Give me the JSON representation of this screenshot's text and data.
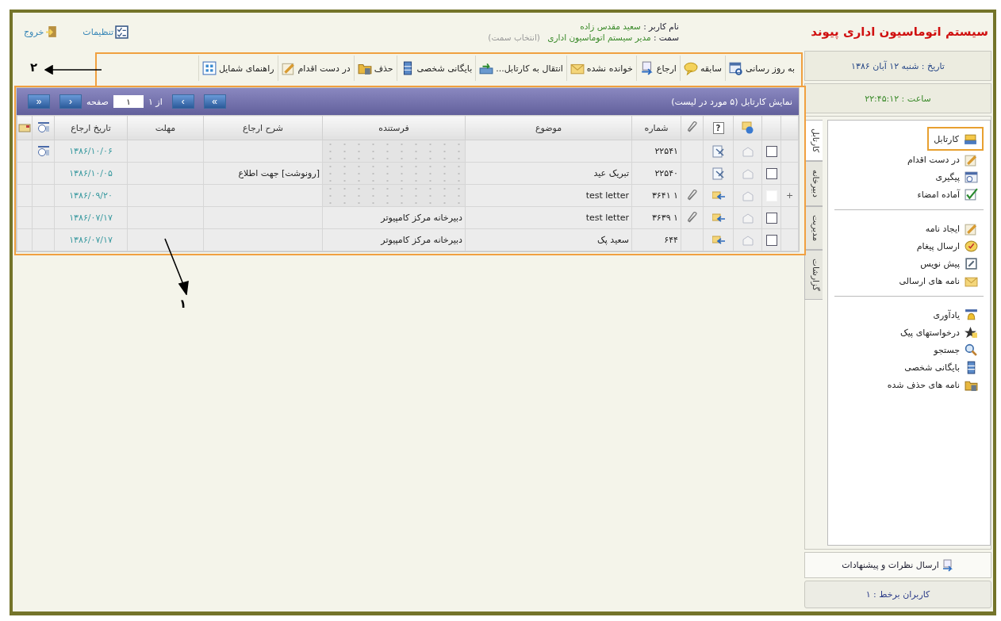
{
  "header": {
    "title": "سیستم اتوماسیون اداری پیوند",
    "user_label": "نام کاربر :",
    "user_name": "سعید مقدس زاده",
    "role_label": "سمت :",
    "role": "مدیر سیستم اتوماسیون اداری",
    "role_link": "(انتخاب سمت)",
    "links": [
      "تنظیمات",
      "خروج"
    ]
  },
  "date": "تاریخ : شنبه ۱۲ آبان ۱۳۸۶",
  "time": "ساعت : ۲۲:۴۵:۱۲",
  "toolbar": [
    "به روز رسانی",
    "سابقه",
    "ارجاع",
    "خوانده نشده",
    "انتقال به کارتابل...",
    "بایگانی شخصی",
    "حذف",
    "در دست اقدام",
    "راهنمای شمایل"
  ],
  "cartable": {
    "caption": "نمایش کارتابل (۵ مورد در لیست)",
    "pager": {
      "first": "«",
      "prev": "‹",
      "page_label": "صفحه",
      "page": "۱",
      "of": "از ۱",
      "next": "›",
      "last": "»"
    },
    "help_mark": "?",
    "columns": [
      "شماره",
      "موضوع",
      "فرستنده",
      "شرح ارجاع",
      "مهلت",
      "تاریخ ارجاع"
    ],
    "rows": [
      {
        "checkbox_shown": true,
        "checked": false,
        "kind": "draft",
        "attachment": false,
        "number": "۲۲۵۴۱",
        "subject": "",
        "sender_redacted": true,
        "sender": "",
        "note": "",
        "date": "۱۳۸۶/۱۰/۰۶",
        "reminder": true
      },
      {
        "checkbox_shown": true,
        "checked": false,
        "kind": "draft",
        "attachment": false,
        "number": "۲۲۵۴۰",
        "subject": "تبریک عید",
        "sender_redacted": true,
        "sender": "",
        "note": "[رونوشت] جهت اطلاع",
        "date": "۱۳۸۶/۱۰/۰۵",
        "reminder": false
      },
      {
        "expander": "+",
        "checkbox_shown": false,
        "checked": false,
        "kind": "forward",
        "attachment": true,
        "number": "۱ ۳۶۴۱",
        "subject": "test letter",
        "sender_redacted": true,
        "sender": "",
        "note": "",
        "date": "۱۳۸۶/۰۹/۲۰",
        "reminder": false
      },
      {
        "checkbox_shown": true,
        "checked": false,
        "kind": "forward",
        "attachment": true,
        "number": "۱ ۳۶۳۹",
        "subject": "test letter",
        "sender_redacted": false,
        "sender": "دبیرخانه مرکز کامپیوتر",
        "note": "",
        "date": "۱۳۸۶/۰۷/۱۷",
        "reminder": false
      },
      {
        "checkbox_shown": true,
        "checked": false,
        "kind": "forward",
        "attachment": false,
        "number": "۶۴۴",
        "subject": "سعید پک",
        "sender_redacted": false,
        "sender": "دبیرخانه مرکز کامپیوتر",
        "note": "",
        "date": "۱۳۸۶/۰۷/۱۷",
        "reminder": false
      }
    ]
  },
  "sidebar": {
    "tabs": [
      {
        "label": "کارتابل",
        "selected": true
      },
      {
        "label": "دبیرخانه",
        "selected": false
      },
      {
        "label": "مدیریت",
        "selected": false
      },
      {
        "label": "گزارشات",
        "selected": false
      }
    ],
    "groups": [
      [
        {
          "label": "کارتابل",
          "selected": true
        },
        {
          "label": "در دست اقدام",
          "selected": false
        },
        {
          "label": "پیگیری",
          "selected": false
        },
        {
          "label": "آماده امضاء",
          "selected": false
        }
      ],
      [
        {
          "label": "ایجاد نامه",
          "selected": false
        },
        {
          "label": "ارسال پیغام",
          "selected": false
        },
        {
          "label": "پیش نویس",
          "selected": false
        },
        {
          "label": "نامه های ارسالی",
          "selected": false
        }
      ],
      [
        {
          "label": "یادآوری",
          "selected": false
        },
        {
          "label": "درخواستهای پیک",
          "selected": false
        },
        {
          "label": "جستجو",
          "selected": false
        },
        {
          "label": "بایگانی شخصی",
          "selected": false
        },
        {
          "label": "نامه های حذف شده",
          "selected": false
        }
      ]
    ],
    "feedback": "ارسال نظرات و پیشنهادات",
    "online": "کاربران برخط : ۱"
  },
  "annotations": [
    {
      "label": "۲"
    },
    {
      "label": "۱"
    }
  ]
}
